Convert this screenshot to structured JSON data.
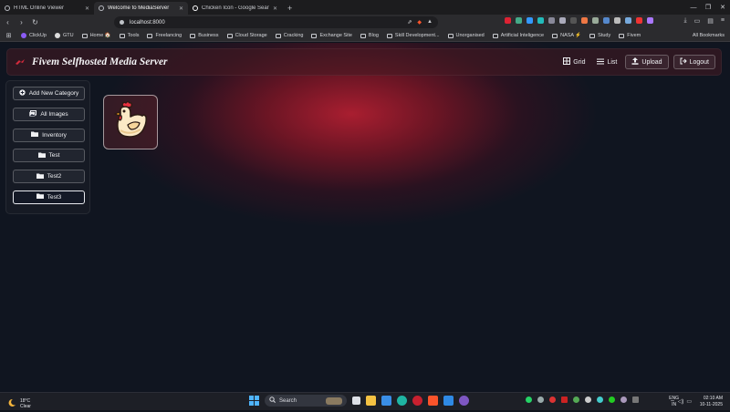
{
  "browser": {
    "tabs": [
      {
        "title": "HTML Online Viewer",
        "active": false
      },
      {
        "title": "Welcome to MediaServer",
        "active": true
      },
      {
        "title": "Chicken Icon - Google Search",
        "active": false
      }
    ],
    "new_tab_symbol": "+",
    "url": "localhost:8000",
    "bookmarks": [
      "ClickUp",
      "GTU",
      "Home 🏠",
      "Tools",
      "Freelancing",
      "Business",
      "Cloud Storage",
      "Cracking",
      "Exchange Site",
      "Blog",
      "Skill Development...",
      "Unorganised",
      "Artificial Inteligence",
      "NASA ⚡",
      "Study",
      "Fivem"
    ],
    "all_bookmarks": "All Bookmarks"
  },
  "app": {
    "brand": "Fivem Selfhosted Media Server",
    "nav": {
      "grid": "Grid",
      "list": "List",
      "upload": "Upload",
      "logout": "Logout"
    },
    "sidebar": [
      {
        "label": "Add New Category",
        "icon": "plus-circle-icon"
      },
      {
        "label": "All Images",
        "icon": "images-icon"
      },
      {
        "label": "Inventory",
        "icon": "folder-icon"
      },
      {
        "label": "Test",
        "icon": "folder-icon"
      },
      {
        "label": "Test2",
        "icon": "folder-icon"
      },
      {
        "label": "Test3",
        "icon": "folder-icon",
        "selected": true
      }
    ],
    "gallery": [
      {
        "icon": "chicken-icon"
      }
    ],
    "colors": {
      "accent": "#a91e30",
      "background": "#0f141d"
    }
  },
  "taskbar": {
    "weather": {
      "temp": "18°C",
      "condition": "Clear"
    },
    "search_placeholder": "Search",
    "lang": {
      "line1": "ENG",
      "line2": "IN"
    },
    "time": "02:10 AM",
    "date": "10-11-2025"
  }
}
